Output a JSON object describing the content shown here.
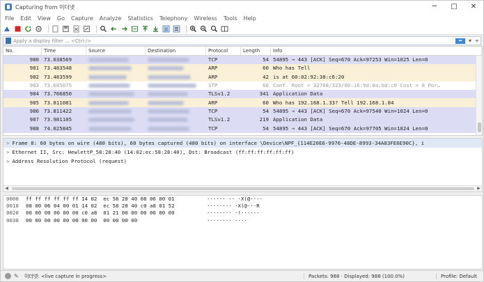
{
  "window": {
    "title": "Capturing from 이더넷",
    "minimize": "─",
    "maximize": "□",
    "close": "✕"
  },
  "menu": [
    "File",
    "Edit",
    "View",
    "Go",
    "Capture",
    "Analyze",
    "Statistics",
    "Telephony",
    "Wireless",
    "Tools",
    "Help"
  ],
  "toolbar_icons": [
    "shark-fin-icon",
    "stop-icon",
    "restart-icon",
    "options-icon",
    "open-icon",
    "save-icon",
    "close-file-icon",
    "reload-icon",
    "find-icon",
    "back-icon",
    "forward-icon",
    "go-to-icon",
    "first-icon",
    "last-icon",
    "autoscroll-icon",
    "colorize-icon",
    "zoom-in-icon",
    "zoom-out-icon",
    "zoom-normal-icon",
    "resize-columns-icon"
  ],
  "filter": {
    "placeholder": "Apply a display filter ... <Ctrl-/>",
    "apply_glyph": "➡",
    "dropdown_glyph": "▾",
    "plus_glyph": "+"
  },
  "packet_list": {
    "columns": [
      "No.",
      "Time",
      "Source",
      "Destination",
      "Protocol",
      "Length",
      "Info"
    ],
    "rows": [
      {
        "no": "980",
        "time": "73.038569",
        "protocol": "TCP",
        "length": "54",
        "info": "54895 → 443 [ACK] Seq=670 Ack=97253 Win=1025 Len=0",
        "bg": "#dcdcf5",
        "fg": "#222222"
      },
      {
        "no": "981",
        "time": "73.483548",
        "protocol": "ARP",
        "length": "60",
        "info": "Who has                Tell",
        "bg": "#faf0d7",
        "fg": "#222222"
      },
      {
        "no": "982",
        "time": "73.483599",
        "protocol": "ARP",
        "length": "42",
        "info": "              is at 60:02:92:38:c6:20",
        "bg": "#faf0d7",
        "fg": "#222222"
      },
      {
        "no": "983",
        "time": "73.685075",
        "protocol": "STP",
        "length": "60",
        "info": "Conf. Root = 32768/323/00:16:9d:0a:bd:c0  Cost = 8  Por…",
        "bg": "#ffffff",
        "fg": "#9a9a9a"
      },
      {
        "no": "984",
        "time": "73.766850",
        "protocol": "TLSv1.2",
        "length": "341",
        "info": "Application Data",
        "bg": "#dcdcf5",
        "fg": "#222222"
      },
      {
        "no": "985",
        "time": "73.811081",
        "protocol": "ARP",
        "length": "60",
        "info": "Who has 192.168.1.33? Tell 192.168.1.84",
        "bg": "#faf0d7",
        "fg": "#222222"
      },
      {
        "no": "986",
        "time": "73.811422",
        "protocol": "TCP",
        "length": "54",
        "info": "54895 → 443 [ACK] Seq=670 Ack=97540 Win=1024 Len=0",
        "bg": "#dcdcf5",
        "fg": "#222222"
      },
      {
        "no": "987",
        "time": "73.981105",
        "protocol": "TLSv1.2",
        "length": "219",
        "info": "Application Data",
        "bg": "#dcdcf5",
        "fg": "#222222"
      },
      {
        "no": "988",
        "time": "74.025845",
        "protocol": "TCP",
        "length": "54",
        "info": "54895 → 443 [ACK] Seq=670 Ack=97705 Win=1024 Len=0",
        "bg": "#dcdcf5",
        "fg": "#222222"
      }
    ]
  },
  "details": {
    "expand_glyph": ">",
    "lines": [
      "Frame 8: 60 bytes on wire (480 bits), 60 bytes captured (480 bits) on interface \\Device\\NPF_{114E20E6-9976-48DE-8993-34A83FE6E90C}, i",
      "Ethernet II, Src: HewlettP_58:28:40 (14:02:ec:58:28:40), Dst: Broadcast (ff:ff:ff:ff:ff:ff)",
      "Address Resolution Protocol (request)"
    ]
  },
  "bytes": [
    {
      "offset": "0000",
      "hex": "ff ff ff ff ff ff 14 02  ec 58 28 40 08 06 00 01",
      "ascii": "······ ·· ·X(@····"
    },
    {
      "offset": "0010",
      "hex": "08 00 06 04 00 01 14 02  ec 58 28 40 c0 a8 01 52",
      "ascii": "········ ·X(@···R"
    },
    {
      "offset": "0020",
      "hex": "00 00 00 00 00 00 c0 a8  01 21 00 00 00 00 00 00",
      "ascii": "········ ·!······"
    },
    {
      "offset": "0030",
      "hex": "00 00 00 00 00 00 00 00  00 00 00 00",
      "ascii": "········ ····"
    }
  ],
  "status": {
    "left": "이더넷: <live capture in progress>",
    "packets": "Packets: 988 · Displayed: 988 (100.0%)",
    "profile": "Profile: Default"
  }
}
